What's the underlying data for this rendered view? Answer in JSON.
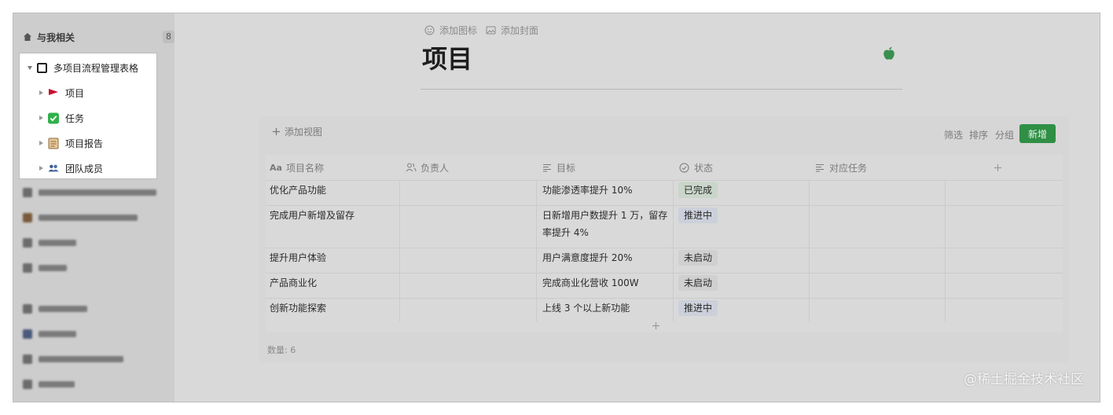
{
  "sidebar": {
    "home": {
      "label": "与我相关",
      "badge": "8"
    },
    "popup": {
      "root": {
        "label": "多项目流程管理表格"
      },
      "items": [
        {
          "label": "项目"
        },
        {
          "label": "任务"
        },
        {
          "label": "项目报告"
        },
        {
          "label": "团队成员"
        }
      ]
    }
  },
  "header": {
    "add_icon": "添加图标",
    "add_cover": "添加封面",
    "title": "项目"
  },
  "toolbar": {
    "add_view": "添加视图",
    "filter": "筛选",
    "sort": "排序",
    "group": "分组",
    "new": "新增"
  },
  "table": {
    "columns": [
      {
        "icon": "text-type-icon",
        "label": "项目名称"
      },
      {
        "icon": "people-icon",
        "label": "负责人"
      },
      {
        "icon": "text-lines-icon",
        "label": "目标"
      },
      {
        "icon": "status-circle-icon",
        "label": "状态"
      },
      {
        "icon": "text-lines-icon",
        "label": "对应任务"
      }
    ],
    "rows": [
      {
        "name": "优化产品功能",
        "owner": "",
        "goal": "功能渗透率提升 10%",
        "status": "已完成",
        "status_color": "#c9d6c9"
      },
      {
        "name": "完成用户新增及留存",
        "owner": "",
        "goal": "日新增用户数提升 1 万，留存率提升 4%",
        "status": "推进中",
        "status_color": "#ccd0db"
      },
      {
        "name": "提升用户体验",
        "owner": "",
        "goal": "用户满意度提升 20%",
        "status": "未启动",
        "status_color": "#d0d0d0"
      },
      {
        "name": "产品商业化",
        "owner": "",
        "goal": "完成商业化营收 100W",
        "status": "未启动",
        "status_color": "#d0d0d0"
      },
      {
        "name": "创新功能探索",
        "owner": "",
        "goal": "上线 3 个以上新功能",
        "status": "推进中",
        "status_color": "#ccd0db"
      }
    ]
  },
  "footer": {
    "count": "数量: 6"
  },
  "watermark": "@稀土掘金技术社区",
  "colors": {
    "accent": "#2f8f45",
    "overlay": "#d9d9d9"
  }
}
